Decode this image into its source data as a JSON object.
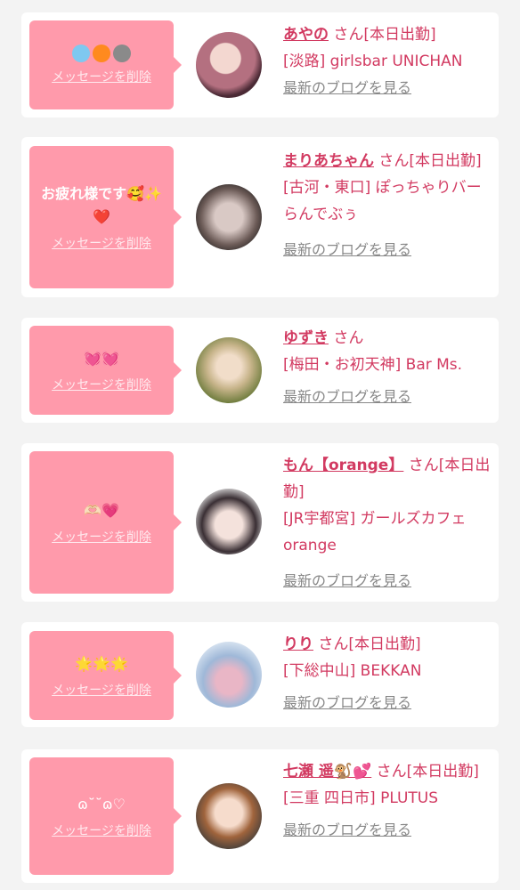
{
  "delete_label": "メッセージを削除",
  "blog_label": "最新のブログを見る",
  "items": [
    {
      "message": "",
      "emoji": [
        "light-blue-heart",
        "orange-heart",
        "grey-heart"
      ],
      "name": "あやの",
      "suffix": "さん[本日出勤]",
      "shop": "[淡路] girlsbar UNICHAN"
    },
    {
      "message": "お疲れ様です🥰✨❤️",
      "emoji": [],
      "name": "まりあちゃん",
      "suffix": "さん[本日出勤]",
      "shop": "[古河・東口] ぽっちゃりバー らんでぶぅ"
    },
    {
      "message": "💓💓",
      "emoji": [],
      "name": "ゆずき",
      "suffix": "さん",
      "shop": "[梅田・お初天神] Bar Ms."
    },
    {
      "message": "🫶🏻💗",
      "emoji": [],
      "name": "もん【orange】",
      "suffix": "さん[本日出勤]",
      "shop": "[JR宇都宮] ガールズカフェ orange"
    },
    {
      "message": "🌟🌟🌟",
      "emoji": [],
      "name": "りり",
      "suffix": "さん[本日出勤]",
      "shop": "[下総中山] BEKKAN"
    },
    {
      "message": "ɷ˘˘ɷ♡",
      "emoji": [],
      "name": "七瀬 遥🐒💕",
      "suffix": "さん[本日出勤]",
      "shop": "[三重 四日市] PLUTUS"
    }
  ],
  "colors": {
    "accent": "#d23a61",
    "bubble": "#ff9aab",
    "card": "#ffffff",
    "bg": "#f3f3f3"
  }
}
